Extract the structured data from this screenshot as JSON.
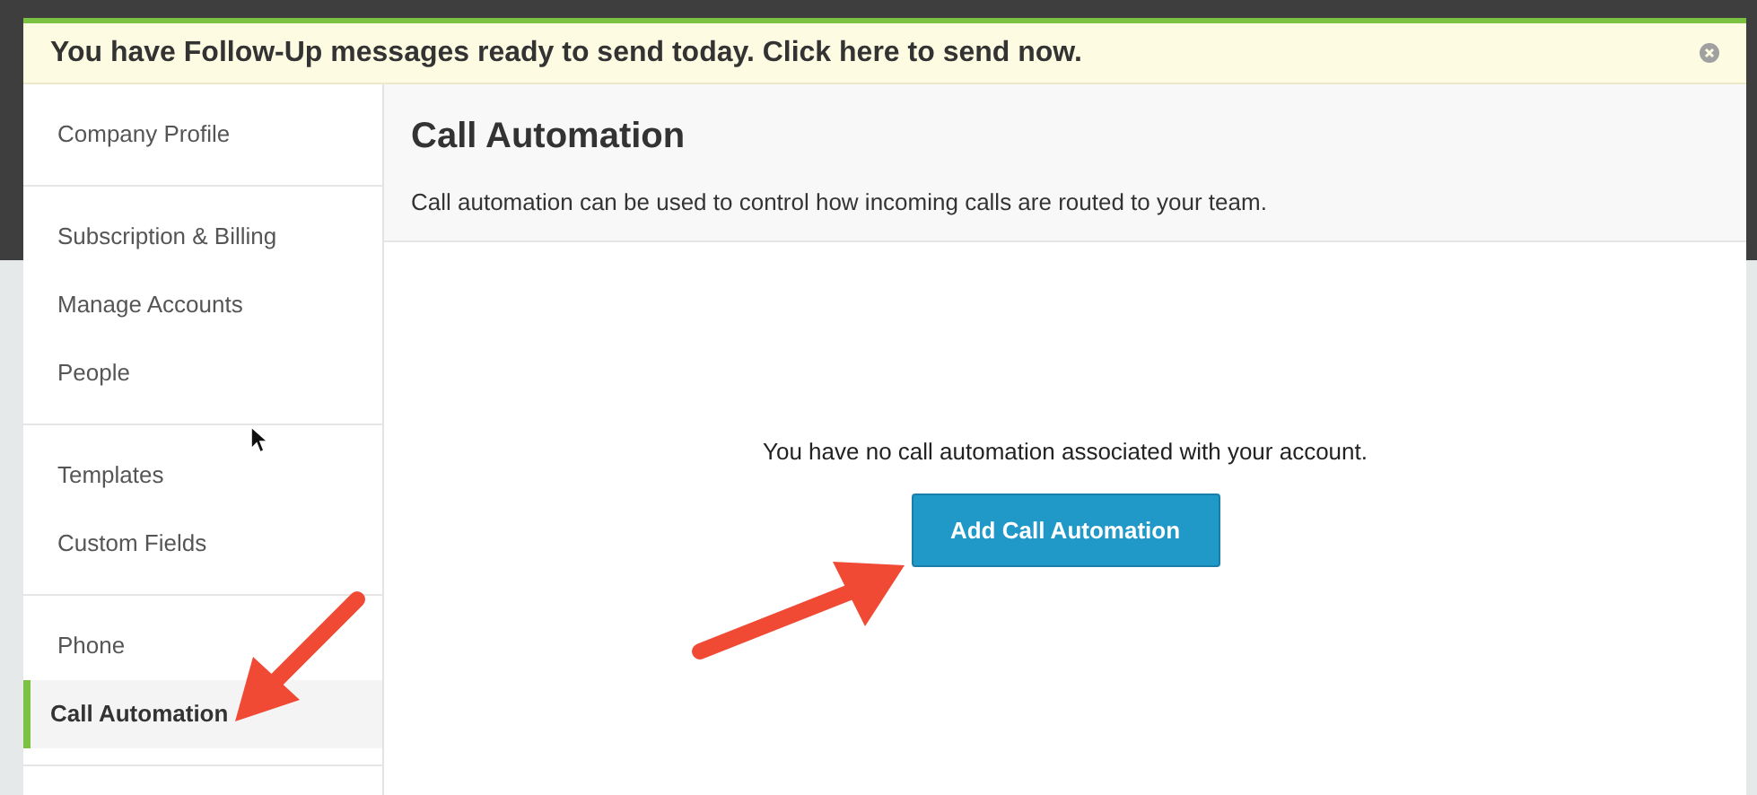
{
  "banner": {
    "text": "You have Follow-Up messages ready to send today. Click here to send now.",
    "dismissible": true
  },
  "sidebar": {
    "groups": [
      {
        "items": [
          {
            "label": "Company Profile",
            "selected": false
          }
        ]
      },
      {
        "items": [
          {
            "label": "Subscription & Billing",
            "selected": false
          },
          {
            "label": "Manage Accounts",
            "selected": false
          },
          {
            "label": "People",
            "selected": false
          }
        ]
      },
      {
        "items": [
          {
            "label": "Templates",
            "selected": false
          },
          {
            "label": "Custom Fields",
            "selected": false
          }
        ]
      },
      {
        "items": [
          {
            "label": "Phone",
            "selected": false
          },
          {
            "label": "Call Automation",
            "selected": true
          }
        ]
      }
    ]
  },
  "main": {
    "title": "Call Automation",
    "description": "Call automation can be used to control how incoming calls are routed to your team.",
    "empty_message": "You have no call automation associated with your account.",
    "button": "Add Call Automation"
  }
}
